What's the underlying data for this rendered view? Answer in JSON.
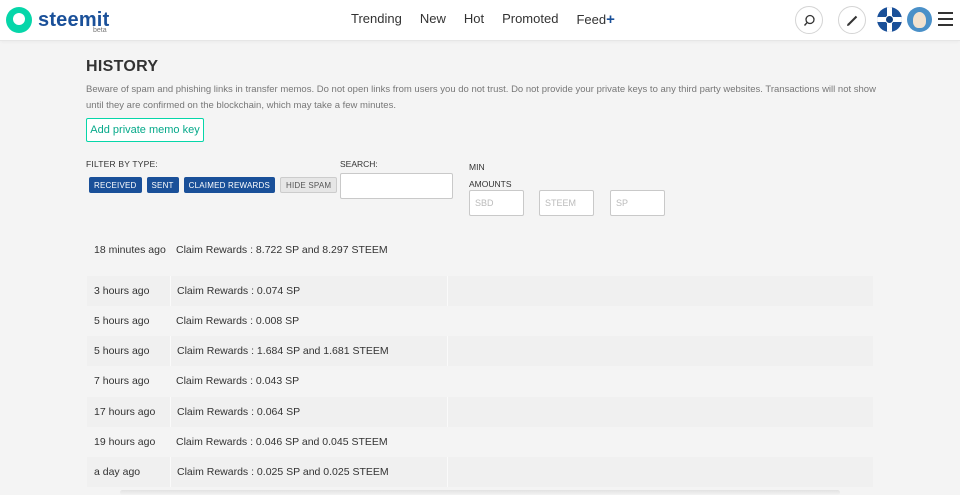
{
  "header": {
    "logo_text": "steemit",
    "logo_badge": "beta",
    "nav": [
      {
        "label": "Trending"
      },
      {
        "label": "New"
      },
      {
        "label": "Hot"
      },
      {
        "label": "Promoted"
      },
      {
        "label": "Feed",
        "suffix": "+"
      }
    ],
    "icons": [
      "search-icon",
      "pencil-icon",
      "user-avatar",
      "user-avatar",
      "menu-icon"
    ]
  },
  "history": {
    "title": "HISTORY",
    "warning": "Beware of spam and phishing links in transfer memos. Do not open links from users you do not trust. Do not provide your private keys to any third party websites. Transactions will not show until they are confirmed on the blockchain, which may take a few minutes.",
    "memo_button": "Add private memo key",
    "filter_label": "FILTER BY TYPE:",
    "filters": [
      {
        "label": "RECEIVED",
        "active": true
      },
      {
        "label": "SENT",
        "active": true
      },
      {
        "label": "CLAIMED REWARDS",
        "active": true
      },
      {
        "label": "HIDE SPAM",
        "active": false
      }
    ],
    "search_label": "SEARCH:",
    "search_value": "",
    "min_amounts_label_1": "MIN",
    "min_amounts_label_2": "AMOUNTS",
    "min_amounts": [
      {
        "placeholder": "SBD"
      },
      {
        "placeholder": "STEEM"
      },
      {
        "placeholder": "SP"
      }
    ],
    "rows": [
      {
        "time": "18 minutes ago",
        "description": "Claim Rewards : 8.722 SP and 8.297 STEEM",
        "memo": ""
      },
      {
        "time": "3 hours ago",
        "description": "Claim Rewards : 0.074 SP",
        "memo": ""
      },
      {
        "time": "5 hours ago",
        "description": "Claim Rewards : 0.008 SP",
        "memo": ""
      },
      {
        "time": "5 hours ago",
        "description": "Claim Rewards : 1.684 SP and 1.681 STEEM",
        "memo": ""
      },
      {
        "time": "7 hours ago",
        "description": "Claim Rewards : 0.043 SP",
        "memo": ""
      },
      {
        "time": "17 hours ago",
        "description": "Claim Rewards : 0.064 SP",
        "memo": ""
      },
      {
        "time": "19 hours ago",
        "description": "Claim Rewards : 0.046 SP and 0.045 STEEM",
        "memo": ""
      },
      {
        "time": "a day ago",
        "description": "Claim Rewards : 0.025 SP and 0.025 STEEM",
        "memo": ""
      }
    ]
  },
  "colors": {
    "brand_blue": "#1a5099",
    "brand_green": "#06d6a9",
    "page_background": "#f4f4f4"
  }
}
